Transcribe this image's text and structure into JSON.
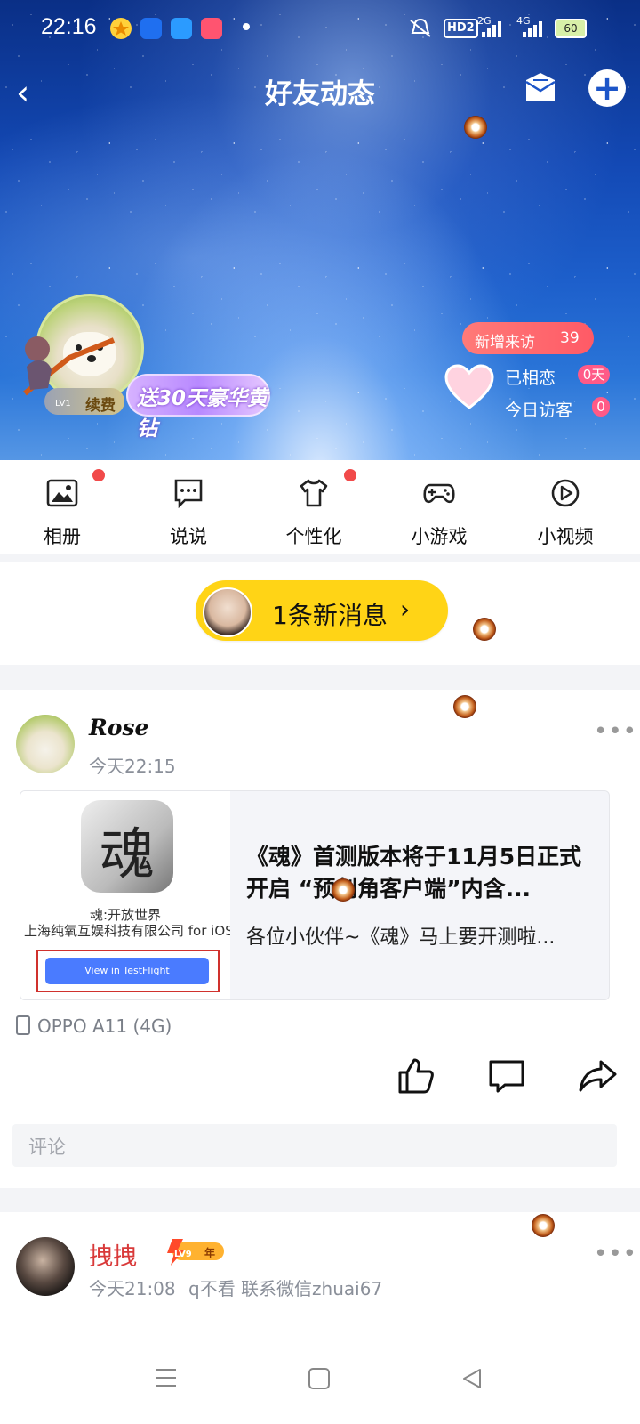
{
  "status_bar": {
    "time": "22:16",
    "network_hd": "HD2",
    "net1": "2G",
    "net2": "4G",
    "battery": "60"
  },
  "header": {
    "title": "好友动态"
  },
  "profile": {
    "level": "LV1",
    "renew_label": "续费",
    "promo_text": "送30天豪华黄钻",
    "new_visits_label": "新增来访",
    "new_visits_count": "39",
    "love_label": "已相恋",
    "love_days": "0天",
    "today_visitors_label": "今日访客",
    "today_visitors_count": "0"
  },
  "nav": {
    "items": [
      {
        "label": "相册",
        "icon": "photo-album-icon",
        "dot": true
      },
      {
        "label": "说说",
        "icon": "chat-bubble-icon",
        "dot": false
      },
      {
        "label": "个性化",
        "icon": "tshirt-icon",
        "dot": true
      },
      {
        "label": "小游戏",
        "icon": "gamepad-icon",
        "dot": false
      },
      {
        "label": "小视频",
        "icon": "play-circle-icon",
        "dot": false
      }
    ]
  },
  "new_message": {
    "text": "1条新消息",
    "chevron": "›"
  },
  "post1": {
    "author": "Rose",
    "time": "今天22:15",
    "more": "•••",
    "card": {
      "app_glyph": "魂",
      "app_name": "魂:开放世界",
      "app_company": "上海纯氧互娱科技有限公司 for iOS",
      "button_label": "View in TestFlight",
      "title": "《魂》首测版本将于11月5日正式开启 “预创角客户端”内含...",
      "desc": "各位小伙伴~《魂》马上要开测啦..."
    },
    "device": "OPPO A11 (4G)",
    "comment_placeholder": "评论"
  },
  "post2": {
    "author": "拽拽",
    "badge_level": "LV9",
    "badge_year": "年",
    "time": "今天21:08",
    "status": "q不看 联系微信zhuai67",
    "more": "•••"
  },
  "colors": {
    "accent_yellow": "#ffd416",
    "red_dot": "#f14a4a",
    "visit_pill": "#ff5a66",
    "link_blue": "#4a7bff"
  }
}
